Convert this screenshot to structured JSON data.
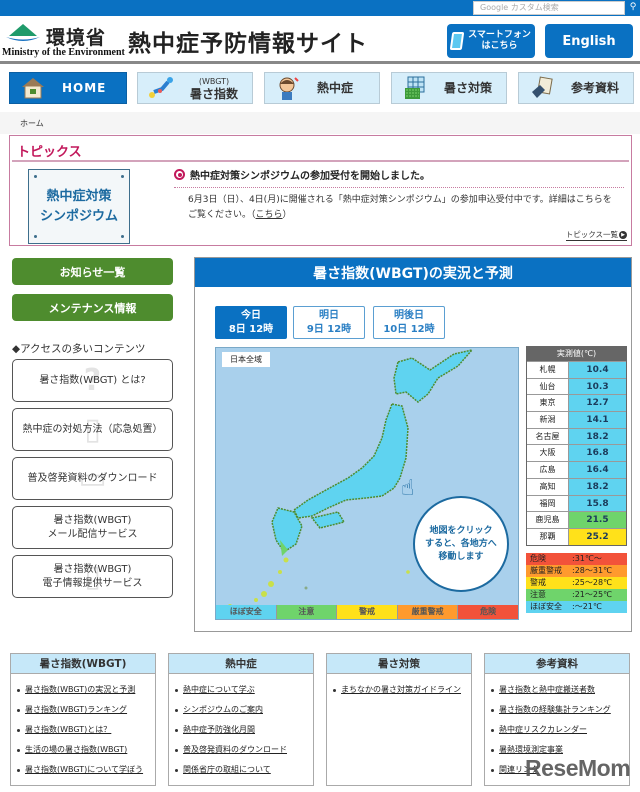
{
  "search": {
    "placeholder": "Google カスタム検索"
  },
  "header": {
    "ministry_jp": "環境省",
    "ministry_en": "Ministry of the Environment",
    "site_title": "熱中症予防情報サイト",
    "smartphone_label_1": "スマートフォン",
    "smartphone_label_2": "はこちら",
    "english_label": "English"
  },
  "nav": {
    "items": [
      {
        "label": "HOME",
        "sub": ""
      },
      {
        "label": "暑さ指数",
        "sub": "(WBGT)"
      },
      {
        "label": "熱中症",
        "sub": ""
      },
      {
        "label": "暑さ対策",
        "sub": ""
      },
      {
        "label": "参考資料",
        "sub": ""
      }
    ]
  },
  "breadcrumb": {
    "home": "ホーム"
  },
  "topics": {
    "title": "トピックス",
    "image_text_1": "熱中症対策",
    "image_text_2": "シンポジウム",
    "headline": "熱中症対策シンポジウムの参加受付を開始しました。",
    "body": "6月3日（日）、4日(月)に開催される「熱中症対策シンポジウム」の参加申込受付中です。詳細はこちらをご覧ください。（",
    "link": "こちら",
    "body_end": "）",
    "more": "トピックス一覧"
  },
  "sidebar": {
    "news_button": "お知らせ一覧",
    "maintenance_button": "メンテナンス情報",
    "access_title": "◆アクセスの多いコンテンツ",
    "access_items": [
      {
        "line1": "暑さ指数(WBGT) とは?",
        "line2": ""
      },
      {
        "line1": "熱中症の対処方法（応急処置）",
        "line2": ""
      },
      {
        "line1": "普及啓発資料のダウンロード",
        "line2": ""
      },
      {
        "line1": "暑さ指数(WBGT)",
        "line2": "メール配信サービス"
      },
      {
        "line1": "暑さ指数(WBGT)",
        "line2": "電子情報提供サービス"
      }
    ]
  },
  "wbgt": {
    "title": "暑さ指数(WBGT)の実況と予測",
    "tabs": [
      {
        "day": "今日",
        "time": "8日 12時",
        "active": true
      },
      {
        "day": "明日",
        "time": "9日 12時",
        "active": false
      },
      {
        "day": "明後日",
        "time": "10日 12時",
        "active": false
      }
    ],
    "map_label": "日本全域",
    "bubble_text_1": "地図をクリック",
    "bubble_text_2": "すると、各地方へ",
    "bubble_text_3": "移動します",
    "legend": [
      {
        "label": "ほぼ安全",
        "color": "#5fd3f0"
      },
      {
        "label": "注意",
        "color": "#6fd46b"
      },
      {
        "label": "警戒",
        "color": "#ffe11a"
      },
      {
        "label": "厳重警戒",
        "color": "#ff9a2e"
      },
      {
        "label": "危険",
        "color": "#f2523a"
      }
    ],
    "observed_header": "実測値(℃)",
    "observed": [
      {
        "city": "札幌",
        "value": "10.4",
        "level": "safe"
      },
      {
        "city": "仙台",
        "value": "10.3",
        "level": "safe"
      },
      {
        "city": "東京",
        "value": "12.7",
        "level": "safe"
      },
      {
        "city": "新潟",
        "value": "14.1",
        "level": "safe"
      },
      {
        "city": "名古屋",
        "value": "18.2",
        "level": "safe"
      },
      {
        "city": "大阪",
        "value": "16.8",
        "level": "safe"
      },
      {
        "city": "広島",
        "value": "16.4",
        "level": "safe"
      },
      {
        "city": "高知",
        "value": "18.2",
        "level": "safe"
      },
      {
        "city": "福岡",
        "value": "15.8",
        "level": "safe"
      },
      {
        "city": "鹿児島",
        "value": "21.5",
        "level": "caution"
      },
      {
        "city": "那覇",
        "value": "25.2",
        "level": "warning"
      }
    ],
    "scale": [
      {
        "label": "危険",
        "range": ":31℃～",
        "color": "#f2523a"
      },
      {
        "label": "厳重警戒",
        "range": ":28～31℃",
        "color": "#ff9a2e"
      },
      {
        "label": "警戒",
        "range": ":25～28℃",
        "color": "#ffe11a"
      },
      {
        "label": "注意",
        "range": ":21～25℃",
        "color": "#6fd46b"
      },
      {
        "label": "ほぼ安全",
        "range": ":～21℃",
        "color": "#5fd3f0"
      }
    ],
    "level_colors": {
      "safe": "#5fd3f0",
      "caution": "#6fd46b",
      "warning": "#ffe11a"
    }
  },
  "footer": {
    "columns": [
      {
        "title": "暑さ指数(WBGT)",
        "links": [
          "暑さ指数(WBGT)の実況と予測",
          "暑さ指数(WBGT)ランキング",
          "暑さ指数(WBGT)とは？",
          "生活の場の暑さ指数(WBGT)",
          "暑さ指数(WBGT)について学ぼう"
        ]
      },
      {
        "title": "熱中症",
        "links": [
          "熱中症について学ぶ",
          "シンポジウムのご案内",
          "熱中症予防強化月間",
          "普及啓発資料のダウンロード",
          "関係省庁の取組について"
        ]
      },
      {
        "title": "暑さ対策",
        "links": [
          "まちなかの暑さ対策ガイドライン"
        ]
      },
      {
        "title": "参考資料",
        "links": [
          "暑さ指数と熱中症搬送者数",
          "暑さ指数の経験集計ランキング",
          "熱中症リスクカレンダー",
          "暑熱環境測定事業",
          "関連リンク"
        ]
      }
    ]
  },
  "watermark": "ReseMom"
}
